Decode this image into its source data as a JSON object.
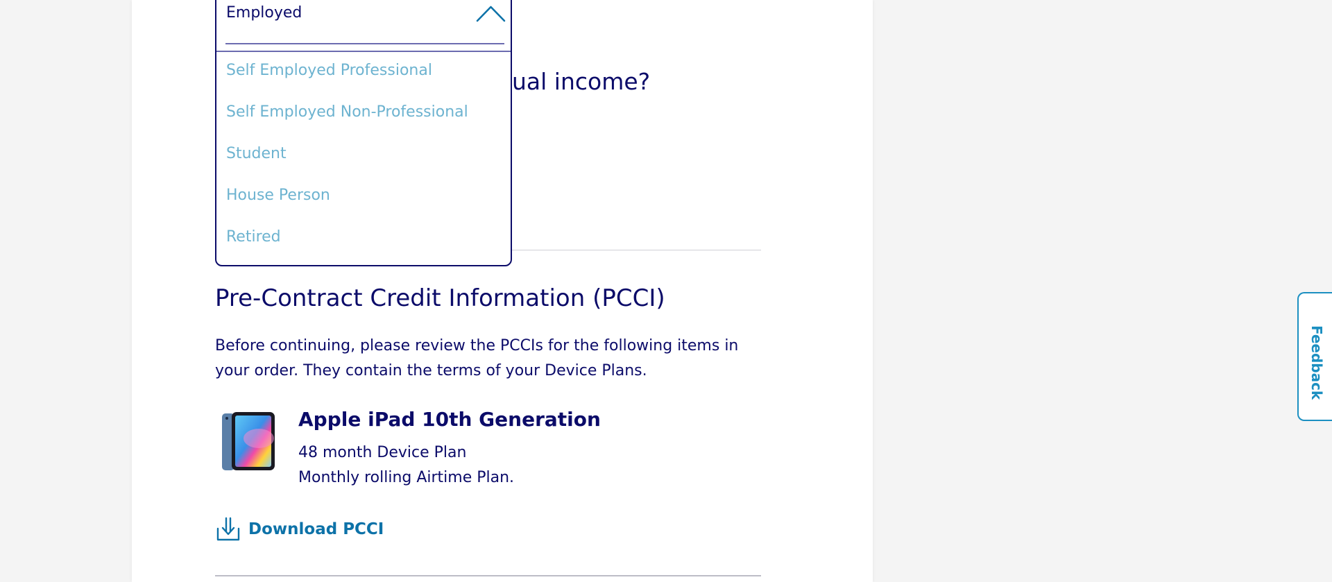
{
  "question": {
    "partial_text": "ual income?"
  },
  "employment_dropdown": {
    "selected": "Employed",
    "options": [
      "Self Employed Professional",
      "Self Employed Non-Professional",
      "Student",
      "House Person",
      "Retired"
    ]
  },
  "pcci": {
    "title": "Pre-Contract Credit Information (PCCI)",
    "description": "Before continuing, please review the PCCIs for the following items in your order. They contain the terms of your Device Plans.",
    "product": {
      "name": "Apple iPad 10th Generation",
      "plan_line_1": "48 month Device Plan",
      "plan_line_2": "Monthly rolling Airtime Plan.",
      "image_icon": "ipad-icon"
    },
    "download_label": "Download PCCI",
    "download_icon": "download-icon"
  },
  "feedback_tab": {
    "label": "Feedback"
  },
  "colors": {
    "navy": "#0b0b69",
    "link_blue": "#0d72a8",
    "option_text": "#6db3d0",
    "feedback_blue": "#1b8fc1",
    "background": "#f4f4f4"
  }
}
